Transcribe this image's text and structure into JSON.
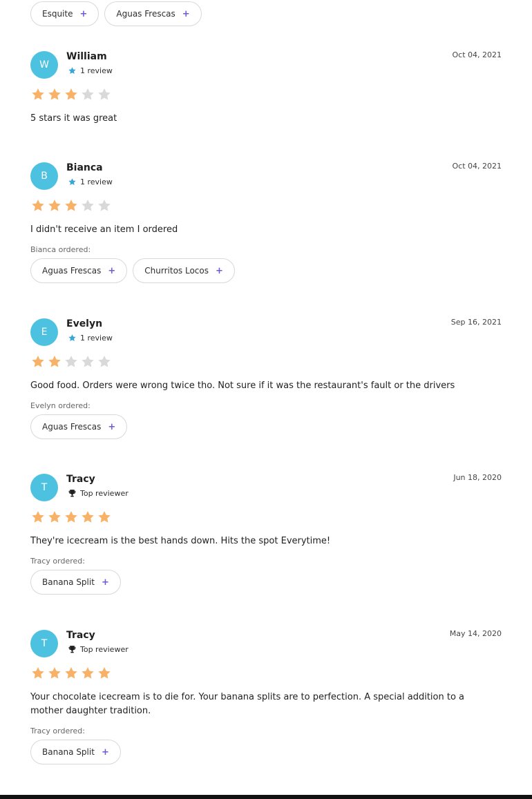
{
  "top_chips": [
    {
      "label": "Esquite"
    },
    {
      "label": "Aguas Frescas"
    }
  ],
  "reviews": [
    {
      "initial": "W",
      "name": "William",
      "meta_icon": "star-icon",
      "meta": "1 review",
      "date": "Oct 04, 2021",
      "rating": 3,
      "text": "5 stars it was great",
      "ordered_label": "",
      "ordered": []
    },
    {
      "initial": "B",
      "name": "Bianca",
      "meta_icon": "star-icon",
      "meta": "1 review",
      "date": "Oct 04, 2021",
      "rating": 3,
      "text": "I didn't receive an item I ordered",
      "ordered_label": "Bianca ordered:",
      "ordered": [
        "Aguas Frescas",
        "Churritos Locos"
      ]
    },
    {
      "initial": "E",
      "name": "Evelyn",
      "meta_icon": "star-icon",
      "meta": "1 review",
      "date": "Sep 16, 2021",
      "rating": 2,
      "text": "Good food. Orders were wrong twice tho. Not sure if it was the restaurant's fault or the drivers",
      "ordered_label": "Evelyn ordered:",
      "ordered": [
        "Aguas Frescas"
      ]
    },
    {
      "initial": "T",
      "name": "Tracy",
      "meta_icon": "trophy-icon",
      "meta": "Top reviewer",
      "date": "Jun 18, 2020",
      "rating": 5,
      "text": "They're icecream is the best hands down. Hits the spot Everytime!",
      "ordered_label": "Tracy ordered:",
      "ordered": [
        "Banana Split"
      ]
    },
    {
      "initial": "T",
      "name": "Tracy",
      "meta_icon": "trophy-icon",
      "meta": "Top reviewer",
      "date": "May 14, 2020",
      "rating": 5,
      "text": "Your chocolate icecream is to die for. Your banana splits are to perfection. A special addition to a mother daughter tradition.",
      "ordered_label": "Tracy ordered:",
      "ordered": [
        "Banana Split"
      ]
    }
  ],
  "colors": {
    "avatar": "#4cc1e0",
    "star_on": "#f7b267",
    "star_off": "#d9d9d9",
    "plus": "#6b5bd6"
  }
}
